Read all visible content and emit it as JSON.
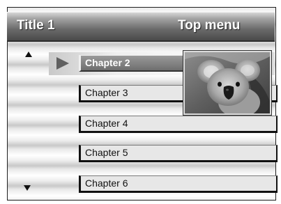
{
  "header": {
    "title_left": "Title 1",
    "title_right": "Top menu"
  },
  "navigation": {
    "up_icon": "triangle-up-icon",
    "down_icon": "triangle-down-icon",
    "play_icon": "play-icon"
  },
  "chapters": [
    {
      "label": "Chapter 2",
      "state": "selected"
    },
    {
      "label": "Chapter 3",
      "state": "normal"
    },
    {
      "label": "Chapter 4",
      "state": "normal"
    },
    {
      "label": "Chapter 5",
      "state": "normal"
    },
    {
      "label": "Chapter 6",
      "state": "normal"
    }
  ],
  "preview": {
    "subject": "koala-photo"
  },
  "colors": {
    "title_bar": "#6a6a6a",
    "selected_item": "#7f7f7f",
    "item_background": "#e7e7e7",
    "item_text": "#111111"
  }
}
